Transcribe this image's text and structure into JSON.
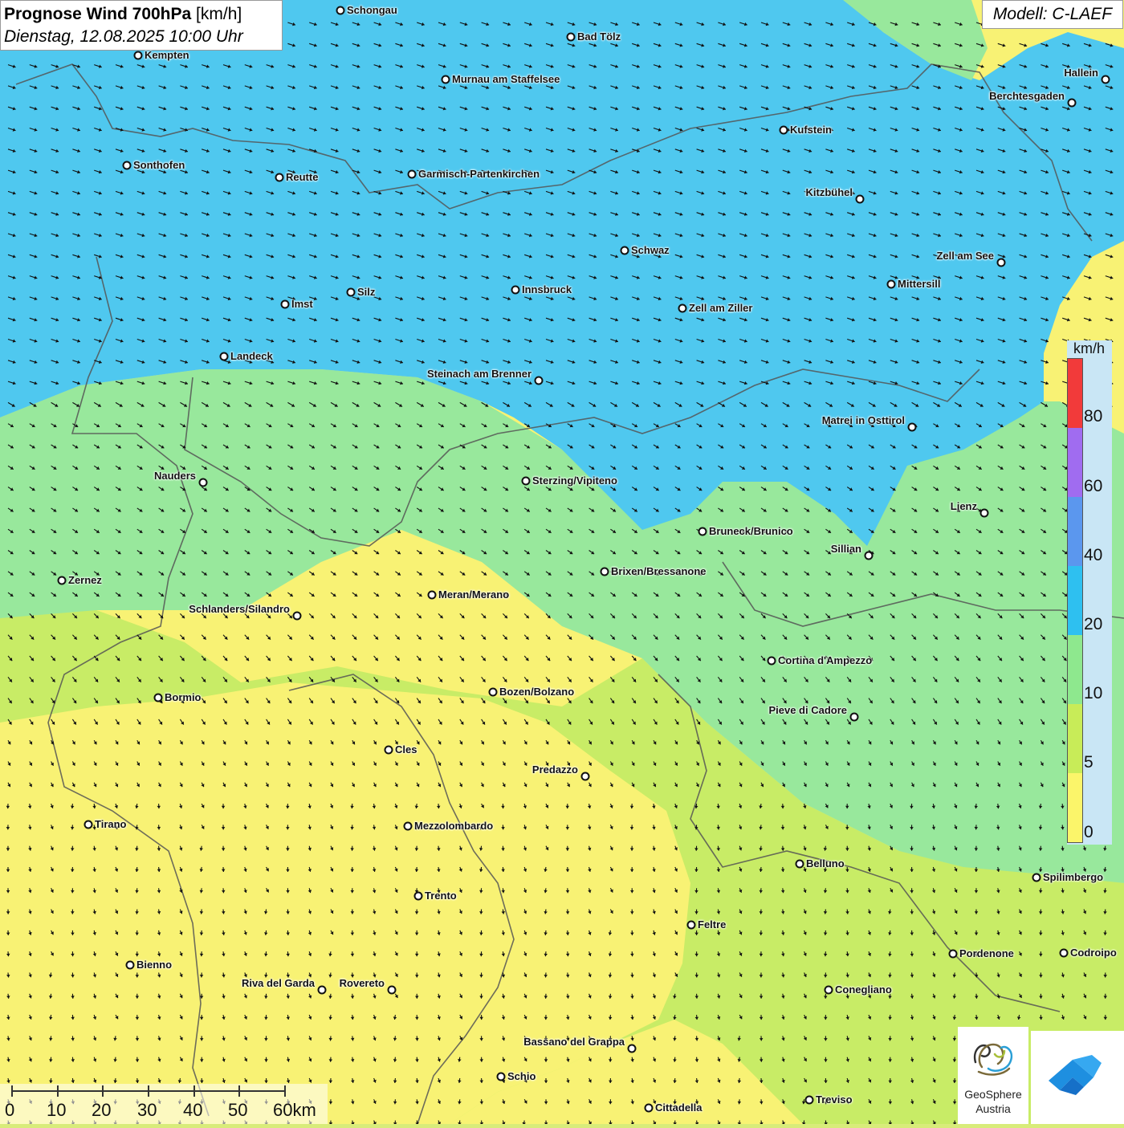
{
  "header": {
    "title_bold": "Prognose Wind 700hPa",
    "title_unit": "[km/h]",
    "subtitle": "Dienstag, 12.08.2025 10:00 Uhr",
    "model": "Modell: C-LAEF"
  },
  "legend": {
    "unit": "km/h",
    "labels": [
      "80",
      "60",
      "40",
      "20",
      "10",
      "5",
      "0"
    ],
    "colors": [
      "#c9e6f5",
      "#f23a3a",
      "#a06cf0",
      "#5b97ee",
      "#2ec0f0",
      "#8ee88e",
      "#c8ec58",
      "#fbf56a"
    ]
  },
  "scale": {
    "labels": [
      "0",
      "10",
      "20",
      "30",
      "40",
      "50",
      "60km"
    ]
  },
  "logo": {
    "line1": "GeoSphere",
    "line2": "Austria"
  },
  "colors": {
    "blue_zone": "#4fc8ef",
    "green_zone": "#98e89c",
    "yellow_green_zone": "#c8ec66",
    "yellow_zone": "#f8f274"
  },
  "cities": [
    {
      "name": "Schongau"
    },
    {
      "name": "Bad Tölz"
    },
    {
      "name": "Kempten"
    },
    {
      "name": "Murnau am Staffelsee"
    },
    {
      "name": "Hallein"
    },
    {
      "name": "Berchtesgaden"
    },
    {
      "name": "Kufstein"
    },
    {
      "name": "Sonthofen"
    },
    {
      "name": "Reutte"
    },
    {
      "name": "Garmisch-Partenkirchen"
    },
    {
      "name": "Kitzbühel"
    },
    {
      "name": "Schwaz"
    },
    {
      "name": "Zell am See"
    },
    {
      "name": "Innsbruck"
    },
    {
      "name": "Mittersill"
    },
    {
      "name": "Silz"
    },
    {
      "name": "Imst"
    },
    {
      "name": "Zell am Ziller"
    },
    {
      "name": "Landeck"
    },
    {
      "name": "Steinach am Brenner"
    },
    {
      "name": "Matrei in Osttirol"
    },
    {
      "name": "Nauders"
    },
    {
      "name": "Sterzing/Vipiteno"
    },
    {
      "name": "Lienz"
    },
    {
      "name": "Bruneck/Brunico"
    },
    {
      "name": "Sillian"
    },
    {
      "name": "Zernez"
    },
    {
      "name": "Brixen/Bressanone"
    },
    {
      "name": "Meran/Merano"
    },
    {
      "name": "Schlanders/Silandro"
    },
    {
      "name": "Cortina d'Ampezzo"
    },
    {
      "name": "Bozen/Bolzano"
    },
    {
      "name": "Bormio"
    },
    {
      "name": "Pieve di Cadore"
    },
    {
      "name": "Cles"
    },
    {
      "name": "Predazzo"
    },
    {
      "name": "Tirano"
    },
    {
      "name": "Mezzolombardo"
    },
    {
      "name": "Belluno"
    },
    {
      "name": "Spilimbergo"
    },
    {
      "name": "Trento"
    },
    {
      "name": "Feltre"
    },
    {
      "name": "Bienno"
    },
    {
      "name": "Pordenone"
    },
    {
      "name": "Codroipo"
    },
    {
      "name": "Riva del Garda"
    },
    {
      "name": "Rovereto"
    },
    {
      "name": "Conegliano"
    },
    {
      "name": "Bassano del Grappa"
    },
    {
      "name": "Schio"
    },
    {
      "name": "Treviso"
    },
    {
      "name": "Cittadella"
    }
  ]
}
